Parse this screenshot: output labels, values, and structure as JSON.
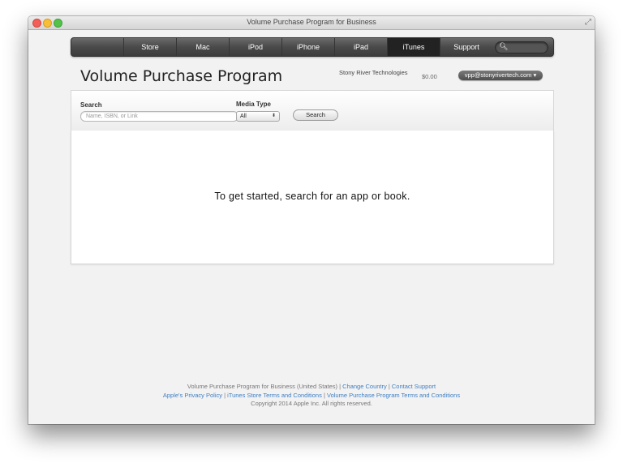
{
  "window": {
    "title": "Volume Purchase Program for Business"
  },
  "nav": {
    "items": [
      "Store",
      "Mac",
      "iPod",
      "iPhone",
      "iPad",
      "iTunes",
      "Support"
    ],
    "active": "iTunes"
  },
  "header": {
    "title": "Volume Purchase Program",
    "account_name": "Stony River Technologies",
    "balance": "$0.00",
    "account_email": "vpp@stonyrivertech.com ▾"
  },
  "search": {
    "label": "Search",
    "placeholder": "Name, ISBN, or Link",
    "media_type_label": "Media Type",
    "media_type_value": "All",
    "button_label": "Search"
  },
  "results": {
    "empty_message": "To get started, search for an app or book."
  },
  "footer": {
    "line1_text": "Volume Purchase Program for Business (United States)",
    "change_country": "Change Country",
    "contact_support": "Contact Support",
    "privacy_policy": "Apple's Privacy Policy",
    "itunes_terms": "iTunes Store Terms and Conditions",
    "vpp_terms": "Volume Purchase Program Terms and Conditions",
    "copyright": "Copyright 2014 Apple Inc. All rights reserved."
  },
  "colors": {
    "link": "#3f7fc3",
    "nav_bg": "#4a4a4a",
    "nav_active": "#222222"
  },
  "icons": {
    "apple": "apple-logo-icon",
    "search": "search-icon"
  }
}
